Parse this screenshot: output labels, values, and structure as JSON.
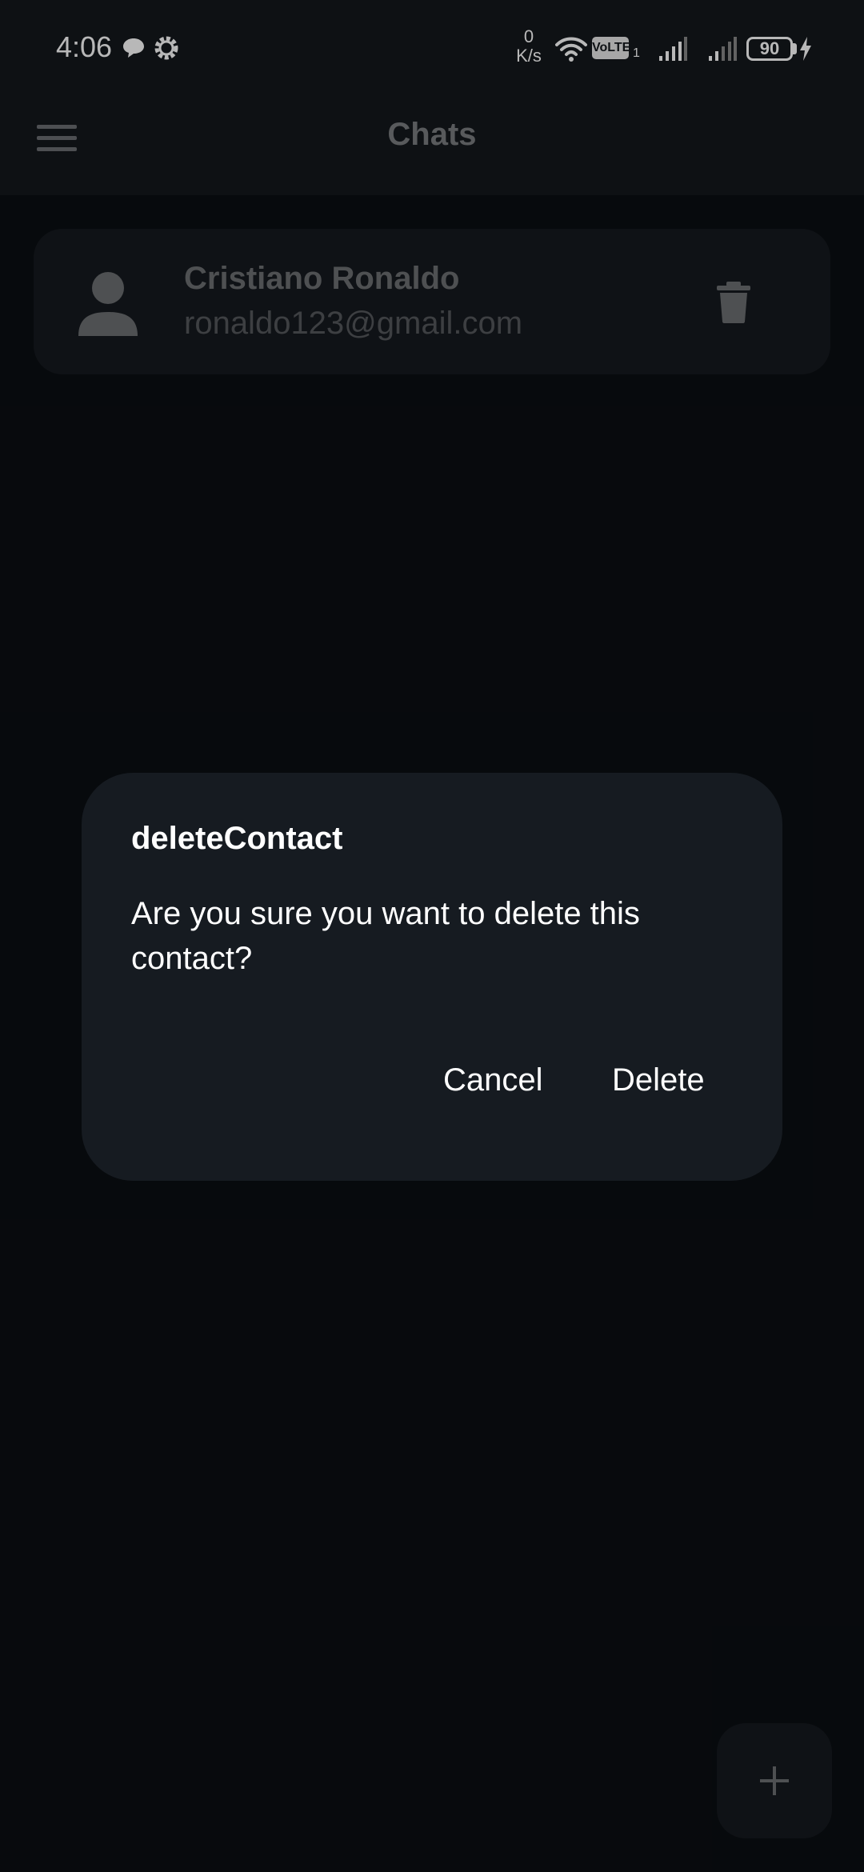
{
  "status_bar": {
    "time": "4:06",
    "net_speed_value": "0",
    "net_speed_unit": "K/s",
    "volte_label": "VoLTE",
    "volte_sim": "1",
    "battery_level": "90",
    "icons": [
      "message-bubble-icon",
      "settings-gear-icon",
      "wifi-icon",
      "signal-icon",
      "signal-icon",
      "charging-bolt-icon"
    ]
  },
  "app_bar": {
    "title": "Chats",
    "menu_icon": "hamburger-menu-icon"
  },
  "contacts": [
    {
      "name": "Cristiano Ronaldo",
      "email": "ronaldo123@gmail.com",
      "avatar_icon": "person-icon",
      "action_icon": "trash-icon"
    }
  ],
  "fab": {
    "icon": "plus-icon"
  },
  "dialog": {
    "title": "deleteContact",
    "message": "Are you sure you want to delete this contact?",
    "cancel_label": "Cancel",
    "delete_label": "Delete"
  },
  "colors": {
    "background": "#0b0e12",
    "surface": "#161a1f",
    "dialog": "#161b21",
    "text_primary": "#ffffff",
    "text_muted": "#6d6f72"
  }
}
